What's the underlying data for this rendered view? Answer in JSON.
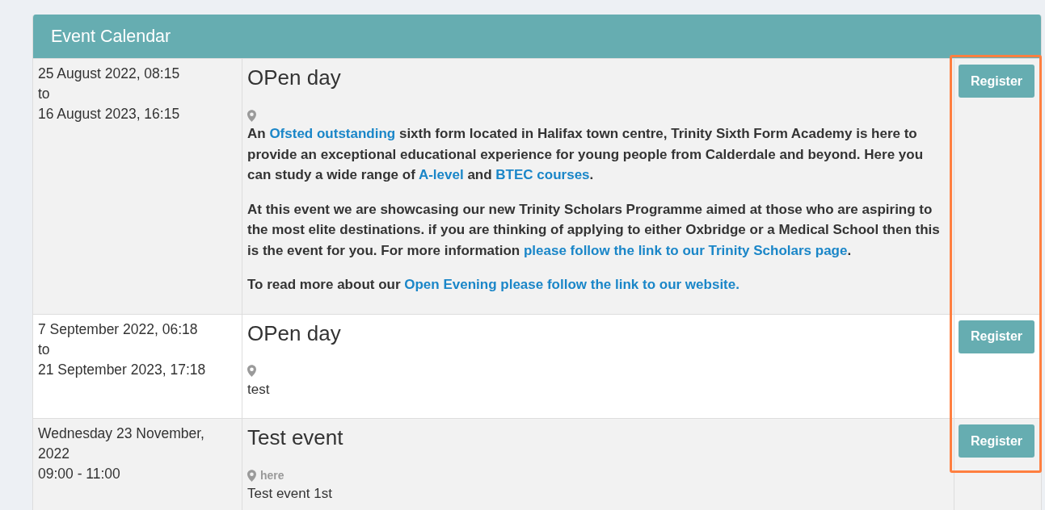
{
  "header": {
    "title": "Event Calendar"
  },
  "register_column_highlighted": true,
  "events": [
    {
      "date_lines": [
        "25 August 2022, 08:15",
        "to",
        "16 August 2023, 16:15"
      ],
      "title": "OPen day",
      "bold": true,
      "description": [
        [
          {
            "kind": "text",
            "text": "An "
          },
          {
            "kind": "link",
            "text": "Ofsted outstanding"
          },
          {
            "kind": "text",
            "text": " sixth form located in Halifax town centre, Trinity Sixth Form Academy is here to provide an exceptional educational experience for young people from Calderdale and beyond. Here you can study a wide range of "
          },
          {
            "kind": "link",
            "text": "A-level"
          },
          {
            "kind": "text",
            "text": " and "
          },
          {
            "kind": "link",
            "text": "BTEC courses"
          },
          {
            "kind": "text",
            "text": "."
          }
        ],
        [
          {
            "kind": "text",
            "text": "At this event we are showcasing our new Trinity Scholars Programme aimed at those who are aspiring to the most elite destinations. if you are thinking of applying to either Oxbridge or a Medical School then this is the event for you. For more information "
          },
          {
            "kind": "link",
            "text": "please follow the link to our Trinity Scholars page"
          },
          {
            "kind": "text",
            "text": "."
          }
        ],
        [
          {
            "kind": "text",
            "text": "To read more about our "
          },
          {
            "kind": "link",
            "text": "Open Evening please follow the link to our website."
          }
        ]
      ],
      "button": "Register"
    },
    {
      "date_lines": [
        "7 September 2022, 06:18",
        "to",
        "21 September 2023, 17:18"
      ],
      "title": "OPen day",
      "bold": false,
      "description": [
        [
          {
            "kind": "text",
            "text": "test"
          }
        ]
      ],
      "button": "Register"
    },
    {
      "date_lines": [
        "Wednesday 23 November, 2022",
        "09:00 - 11:00"
      ],
      "title": "Test event",
      "location": "here",
      "bold": false,
      "description": [
        [
          {
            "kind": "text",
            "text": "Test event 1st"
          }
        ]
      ],
      "button": "Register"
    }
  ]
}
